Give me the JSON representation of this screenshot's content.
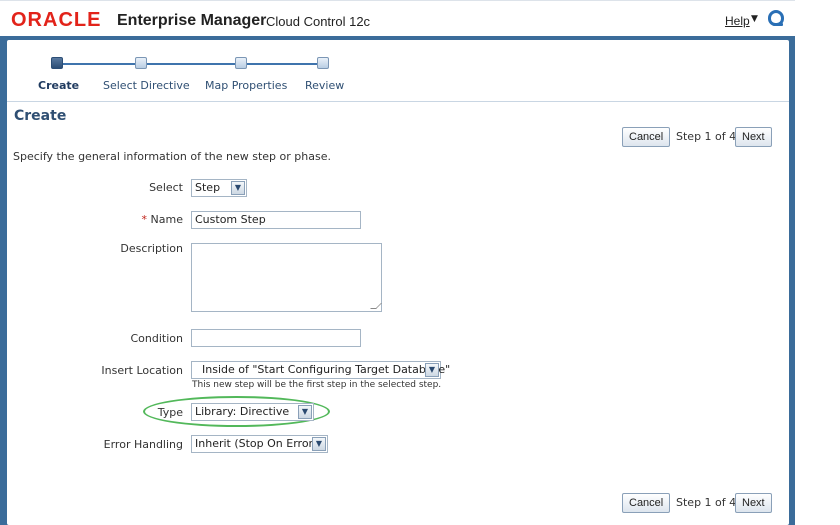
{
  "header": {
    "logo": "ORACLE",
    "product": "Enterprise Manager",
    "product_sub": "Cloud Control 12c",
    "help_label": "Help"
  },
  "train": {
    "steps": [
      {
        "label": "Create",
        "current": true
      },
      {
        "label": "Select Directive",
        "current": false
      },
      {
        "label": "Map Properties",
        "current": false
      },
      {
        "label": "Review",
        "current": false
      }
    ]
  },
  "page": {
    "title": "Create",
    "intro": "Specify the general information of the new step or phase."
  },
  "nav": {
    "cancel_label": "Cancel",
    "step_text": "Step 1 of 4",
    "next_label": "Next"
  },
  "form": {
    "select": {
      "label": "Select",
      "value": "Step"
    },
    "name": {
      "label": "Name",
      "required_mark": "*",
      "value": "Custom Step"
    },
    "description": {
      "label": "Description",
      "value": ""
    },
    "condition": {
      "label": "Condition",
      "value": ""
    },
    "insert_location": {
      "label": "Insert Location",
      "value": "Inside of \"Start Configuring Target Database\"",
      "hint": "This new step will be the first step in the selected step."
    },
    "type": {
      "label": "Type",
      "value": "Library: Directive"
    },
    "error_handling": {
      "label": "Error Handling",
      "value": "Inherit (Stop On Error)"
    }
  },
  "colors": {
    "oracle_red": "#e2231a",
    "frame_blue": "#3b6c9a",
    "highlight_green": "#52b85a"
  }
}
